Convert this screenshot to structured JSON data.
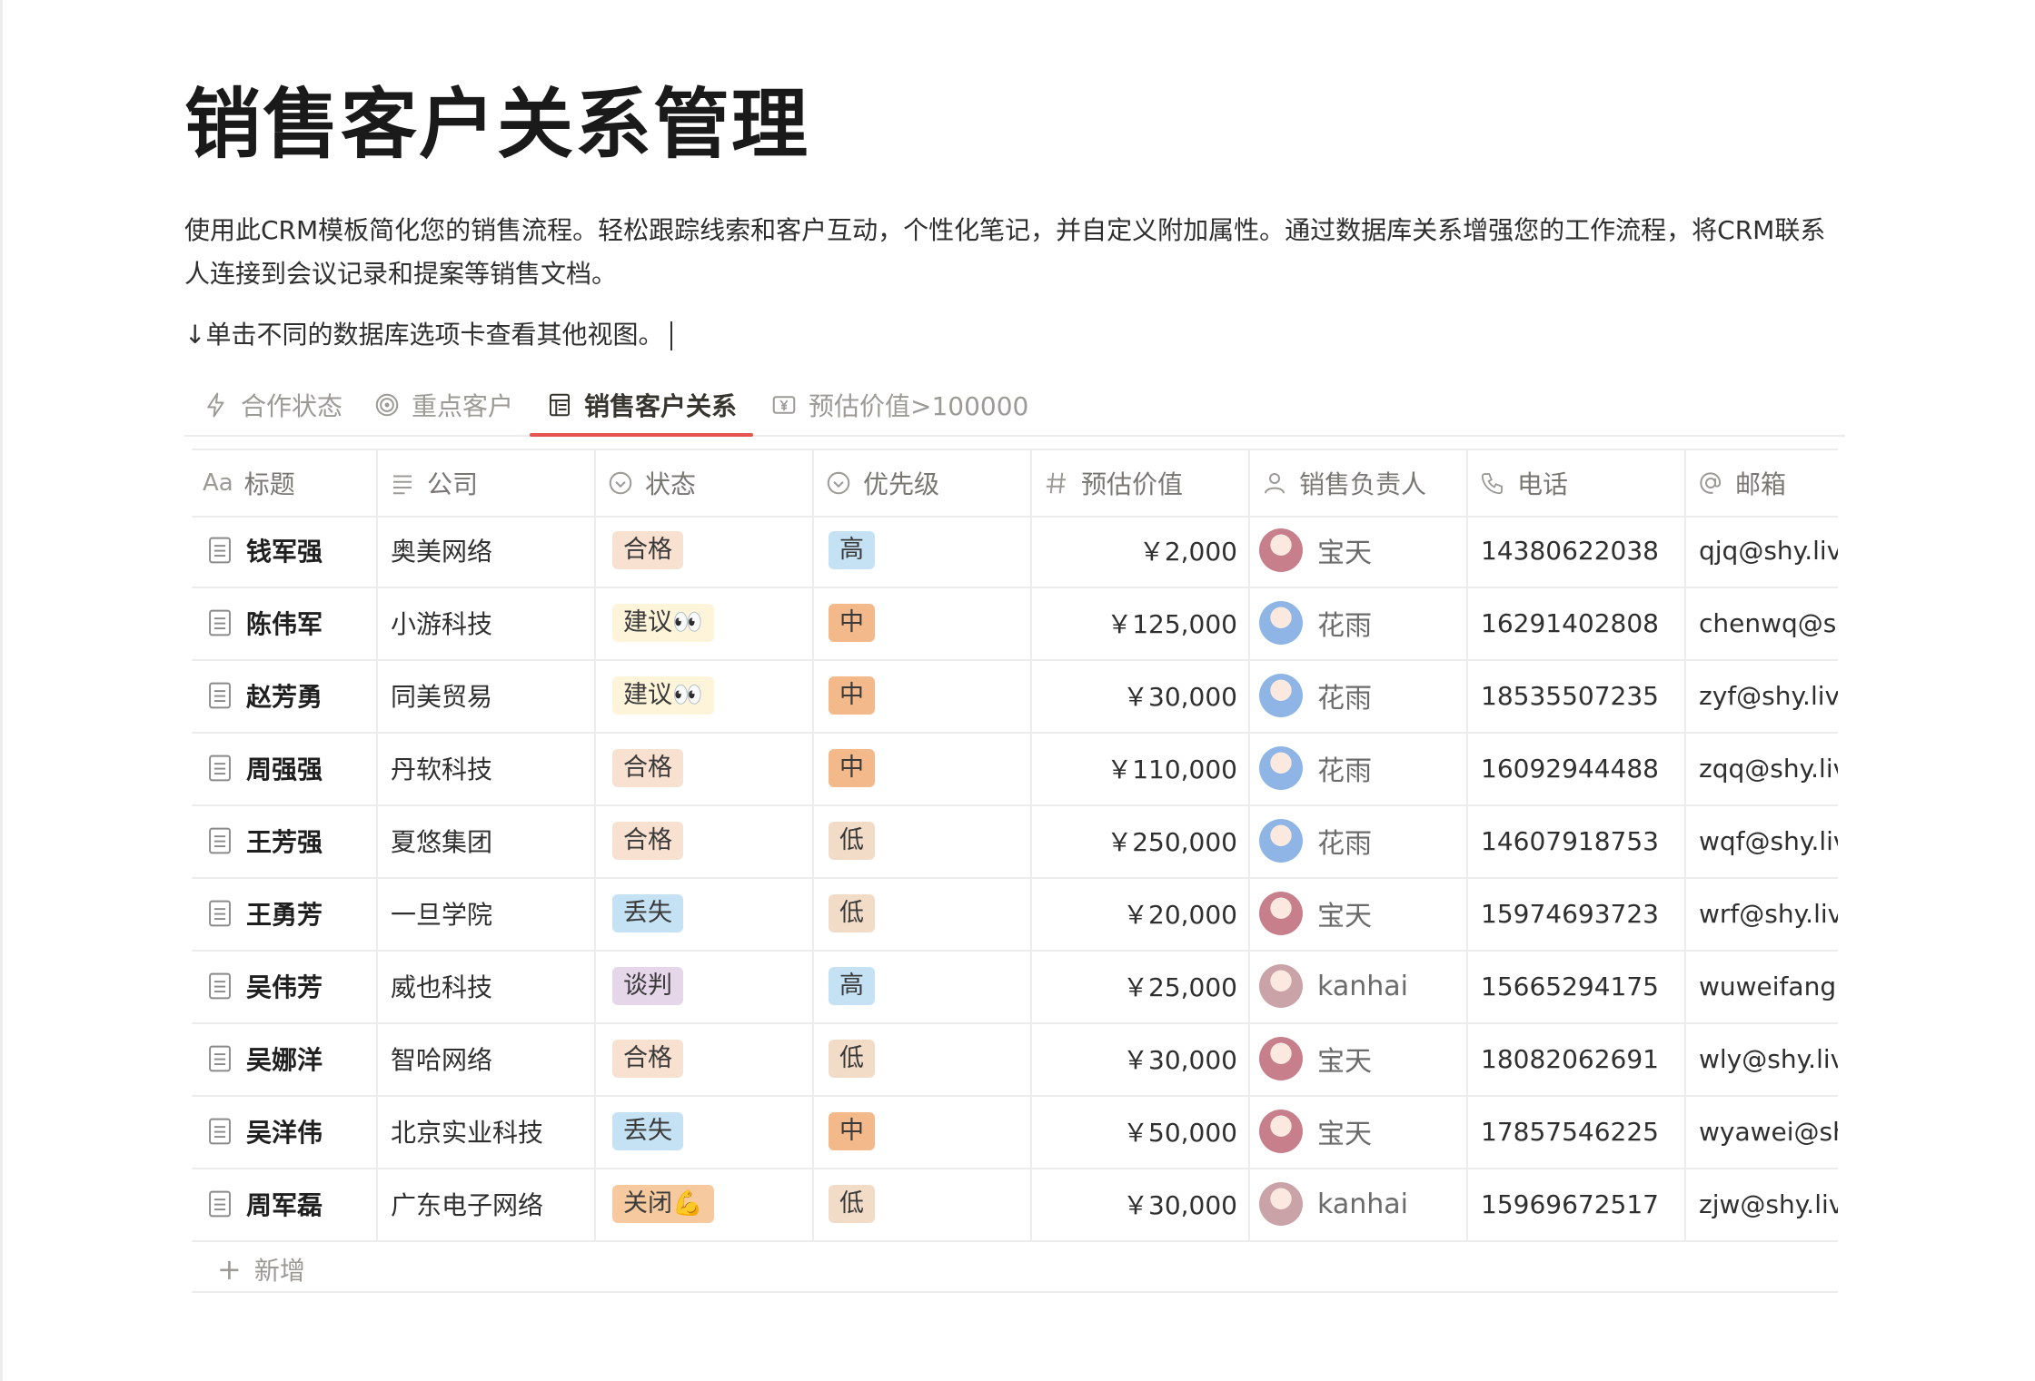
{
  "page": {
    "title": "销售客户关系管理",
    "description": "使用此CRM模板简化您的销售流程。轻松跟踪线索和客户互动，个性化笔记，并自定义附加属性。通过数据库关系增强您的工作流程，将CRM联系人连接到会议记录和提案等销售文档。",
    "hint": "↓单击不同的数据库选项卡查看其他视图。"
  },
  "tabs": [
    {
      "label": "合作状态",
      "icon": "lightning-icon",
      "active": false
    },
    {
      "label": "重点客户",
      "icon": "target-icon",
      "active": false
    },
    {
      "label": "销售客户关系",
      "icon": "table-icon",
      "active": true
    },
    {
      "label": "预估价值>100000",
      "icon": "yen-icon",
      "active": false
    }
  ],
  "columns": [
    {
      "label": "标题",
      "icon": "title-aa-icon"
    },
    {
      "label": "公司",
      "icon": "text-lines-icon"
    },
    {
      "label": "状态",
      "icon": "status-icon"
    },
    {
      "label": "优先级",
      "icon": "select-icon"
    },
    {
      "label": "预估价值",
      "icon": "hash-icon"
    },
    {
      "label": "销售负责人",
      "icon": "person-icon"
    },
    {
      "label": "电话",
      "icon": "phone-icon"
    },
    {
      "label": "邮箱",
      "icon": "at-icon"
    }
  ],
  "rows": [
    {
      "name": "钱军强",
      "company": "奥美网络",
      "status": "合格",
      "priority": "高",
      "value": "￥2,000",
      "owner": "宝天",
      "phone": "14380622038",
      "email": "qjq@shy.live"
    },
    {
      "name": "陈伟军",
      "company": "小游科技",
      "status": "建议👀",
      "priority": "中",
      "value": "￥125,000",
      "owner": "花雨",
      "phone": "16291402808",
      "email": "chenwq@shy.live"
    },
    {
      "name": "赵芳勇",
      "company": "同美贸易",
      "status": "建议👀",
      "priority": "中",
      "value": "￥30,000",
      "owner": "花雨",
      "phone": "18535507235",
      "email": "zyf@shy.live"
    },
    {
      "name": "周强强",
      "company": "丹软科技",
      "status": "合格",
      "priority": "中",
      "value": "￥110,000",
      "owner": "花雨",
      "phone": "16092944488",
      "email": "zqq@shy.live"
    },
    {
      "name": "王芳强",
      "company": "夏悠集团",
      "status": "合格",
      "priority": "低",
      "value": "￥250,000",
      "owner": "花雨",
      "phone": "14607918753",
      "email": "wqf@shy.live"
    },
    {
      "name": "王勇芳",
      "company": "一旦学院",
      "status": "丢失",
      "priority": "低",
      "value": "￥20,000",
      "owner": "宝天",
      "phone": "15974693723",
      "email": "wrf@shy.live"
    },
    {
      "name": "吴伟芳",
      "company": "威也科技",
      "status": "谈判",
      "priority": "高",
      "value": "￥25,000",
      "owner": "kanhai",
      "phone": "15665294175",
      "email": "wuweifang@shy.live"
    },
    {
      "name": "吴娜洋",
      "company": "智哈网络",
      "status": "合格",
      "priority": "低",
      "value": "￥30,000",
      "owner": "宝天",
      "phone": "18082062691",
      "email": "wly@shy.live"
    },
    {
      "name": "吴洋伟",
      "company": "北京实业科技",
      "status": "丢失",
      "priority": "中",
      "value": "￥50,000",
      "owner": "宝天",
      "phone": "17857546225",
      "email": "wyawei@shy.live"
    },
    {
      "name": "周军磊",
      "company": "广东电子网络",
      "status": "关闭💪",
      "priority": "低",
      "value": "￥30,000",
      "owner": "kanhai",
      "phone": "15969672517",
      "email": "zjw@shy.live"
    }
  ],
  "add_row_label": "新增",
  "colors": {
    "合格": "#f8e1d1",
    "建议👀": "#fdf4d9",
    "丢失": "#c5e2f5",
    "谈判": "#e5d6ea",
    "关闭💪": "#f6c99f",
    "高": "#c5e2f5",
    "中": "#f4b98a",
    "低": "#f2dcc8",
    "active_tab": "#e3534f"
  },
  "avatars": {
    "宝天": "#c77f8c",
    "花雨": "#8fb5e6",
    "kanhai": "#c9a3a8"
  }
}
